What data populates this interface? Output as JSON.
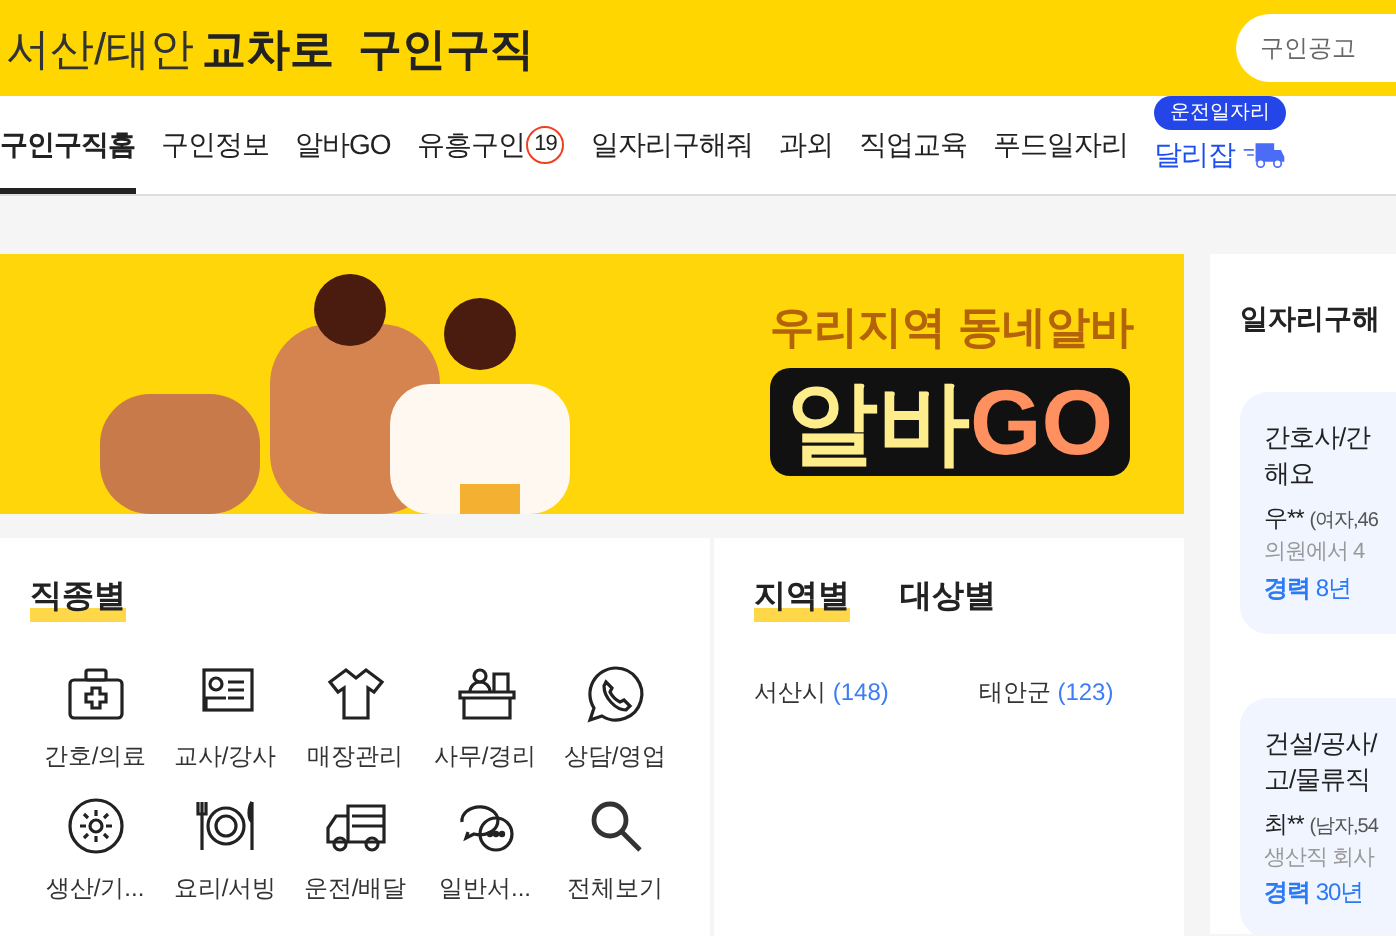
{
  "header": {
    "region": "서산/태안",
    "brand": "교차로",
    "title": "구인구직",
    "search": {
      "placeholder": "구인공고"
    }
  },
  "nav": {
    "items": [
      {
        "label": "구인구직홈",
        "selected": true
      },
      {
        "label": "구인정보",
        "selected": false
      },
      {
        "label": "알바GO",
        "selected": false
      },
      {
        "label": "유흥구인",
        "selected": false,
        "badge": "19"
      },
      {
        "label": "일자리구해줘",
        "selected": false
      },
      {
        "label": "과외",
        "selected": false
      },
      {
        "label": "직업교육",
        "selected": false
      },
      {
        "label": "푸드일자리",
        "selected": false
      },
      {
        "label": "달리잡",
        "selected": false,
        "tag": "운전일자리",
        "kind": "highlight"
      }
    ]
  },
  "banner": {
    "subtitle": "우리지역 동네알바",
    "title_a": "알바",
    "title_b": "GO"
  },
  "job_types": {
    "title": "직종별",
    "items": [
      {
        "label": "간호/의료",
        "kind": "medkit"
      },
      {
        "label": "교사/강사",
        "kind": "teacher"
      },
      {
        "label": "매장관리",
        "kind": "shirt"
      },
      {
        "label": "사무/경리",
        "kind": "desk"
      },
      {
        "label": "상담/영업",
        "kind": "phone"
      },
      {
        "label": "생산/기...",
        "kind": "gear"
      },
      {
        "label": "요리/서빙",
        "kind": "dish"
      },
      {
        "label": "운전/배달",
        "kind": "truck"
      },
      {
        "label": "일반서...",
        "kind": "chat"
      },
      {
        "label": "전체보기",
        "kind": "search"
      }
    ]
  },
  "region_tabs": [
    {
      "label": "지역별",
      "selected": true
    },
    {
      "label": "대상별",
      "selected": false
    }
  ],
  "regions": [
    {
      "name": "서산시",
      "count": "(148)"
    },
    {
      "name": "태안군",
      "count": "(123)"
    }
  ],
  "side": {
    "title": "일자리구해",
    "cards": [
      {
        "title": "간호사/간",
        "title2": "해요",
        "person": "우**",
        "info": "(여자,46",
        "desc": "의원에서 4",
        "career_label": "경력",
        "career": "8년"
      },
      {
        "title": "건설/공사/",
        "title2": "고/물류직",
        "person": "최**",
        "info": "(남자,54",
        "desc": "생산직 회사",
        "career_label": "경력",
        "career": "30년"
      }
    ]
  }
}
